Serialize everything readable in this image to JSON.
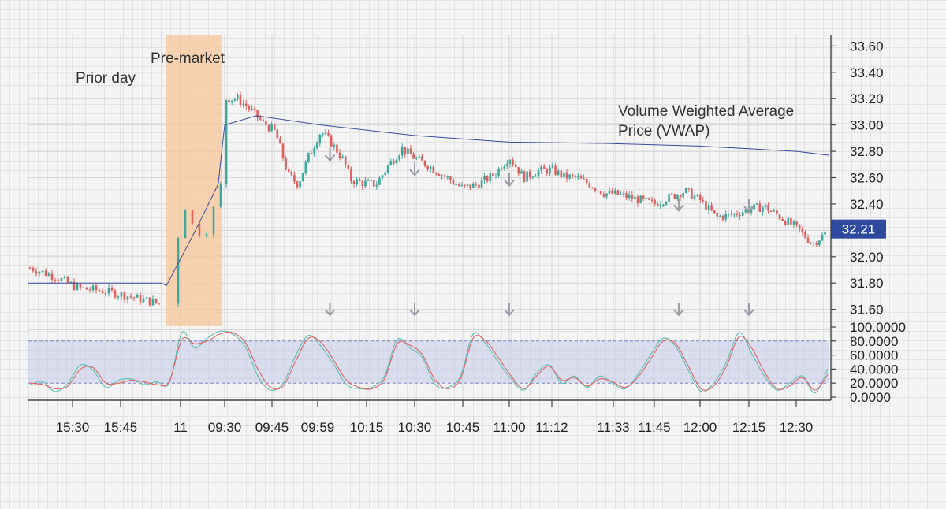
{
  "chart_data": {
    "type": "candlestick",
    "x_tick_labels": [
      "15:30",
      "15:45",
      "11",
      "09:30",
      "09:45",
      "09:59",
      "10:15",
      "10:30",
      "10:45",
      "11:00",
      "11:12",
      "11:33",
      "11:45",
      "12:00",
      "12:15",
      "12:30"
    ],
    "price_axis": {
      "ylim": [
        31.55,
        33.65
      ],
      "tick_values": [
        31.6,
        31.8,
        32.0,
        32.2,
        32.4,
        32.6,
        32.8,
        33.0,
        33.2,
        33.4,
        33.6
      ],
      "tick_labels": [
        "31.60",
        "31.80",
        "32.00",
        "32.20",
        "32.40",
        "32.60",
        "32.80",
        "33.00",
        "33.20",
        "33.40",
        "33.60"
      ]
    },
    "last_price_label": "32.21",
    "last_price": 32.21,
    "annotations": {
      "prior_day": "Prior day",
      "pre_market": "Pre-market",
      "vwap_line1": "Volume Weighted Average",
      "vwap_line2": "Price (VWAP)"
    },
    "vwap": {
      "x": [
        "15:20",
        "15:54",
        "08:00",
        "08:30",
        "08:45",
        "09:20",
        "09:30",
        "09:40",
        "10:00",
        "10:30",
        "11:00",
        "11:30",
        "12:00",
        "12:15",
        "12:30",
        "12:40"
      ],
      "values": [
        31.8,
        31.8,
        31.78,
        32.06,
        32.2,
        32.55,
        33.0,
        33.07,
        33.0,
        32.92,
        32.87,
        32.86,
        32.84,
        32.82,
        32.8,
        32.77
      ]
    },
    "price_path": {
      "x": [
        "15:20",
        "15:26",
        "15:32",
        "15:40",
        "15:48",
        "15:54",
        "08:30",
        "08:45",
        "09:05",
        "09:15",
        "09:25",
        "09:30",
        "09:34",
        "09:38",
        "09:42",
        "09:46",
        "09:50",
        "09:53",
        "09:56",
        "10:00",
        "10:03",
        "10:07",
        "10:10",
        "10:14",
        "10:18",
        "10:22",
        "10:26",
        "10:30",
        "10:35",
        "10:40",
        "10:45",
        "10:50",
        "10:55",
        "11:00",
        "11:04",
        "11:08",
        "11:12",
        "11:16",
        "11:20",
        "11:25",
        "11:30",
        "11:33",
        "11:38",
        "11:45",
        "11:50",
        "11:55",
        "12:00",
        "12:05",
        "12:10",
        "12:15",
        "12:20",
        "12:25",
        "12:30",
        "12:35",
        "12:40"
      ],
      "values": [
        31.92,
        31.85,
        31.76,
        31.74,
        31.69,
        31.64,
        32.4,
        32.17,
        32.21,
        32.4,
        32.55,
        33.2,
        33.2,
        33.12,
        33.02,
        32.95,
        32.62,
        32.55,
        32.75,
        32.95,
        32.88,
        32.75,
        32.58,
        32.56,
        32.55,
        32.7,
        32.82,
        32.75,
        32.68,
        32.6,
        32.52,
        32.55,
        32.62,
        32.76,
        32.6,
        32.65,
        32.66,
        32.61,
        32.6,
        32.55,
        32.48,
        32.48,
        32.45,
        32.4,
        32.45,
        32.5,
        32.43,
        32.3,
        32.32,
        32.36,
        32.38,
        32.3,
        32.22,
        32.1,
        32.2
      ]
    },
    "session_gap_label": "11",
    "signal_arrows": {
      "price_panel": [
        {
          "x": "10:03",
          "y": 32.73
        },
        {
          "x": "10:30",
          "y": 32.62
        },
        {
          "x": "11:00",
          "y": 32.54
        },
        {
          "x": "11:53",
          "y": 32.35
        },
        {
          "x": "12:15",
          "y": 32.34
        }
      ],
      "oscillator_panel": [
        "10:03",
        "10:30",
        "11:00",
        "11:53",
        "12:15"
      ]
    },
    "oscillator": {
      "ylim": [
        0,
        100
      ],
      "tick_values": [
        0,
        20,
        40,
        60,
        80,
        100
      ],
      "tick_labels": [
        "0.0000",
        "20.0000",
        "40.0000",
        "60.0000",
        "80.0000",
        "100.0000"
      ],
      "overbought": 80,
      "oversold": 20,
      "band_color": "#c8cdea",
      "series": [
        {
          "color": "#5bbfb0",
          "values": [
            18,
            22,
            8,
            20,
            46,
            38,
            14,
            24,
            26,
            18,
            22,
            20,
            92,
            70,
            84,
            94,
            90,
            72,
            30,
            10,
            20,
            60,
            88,
            72,
            46,
            18,
            12,
            14,
            30,
            82,
            70,
            56,
            18,
            14,
            30,
            90,
            76,
            50,
            26,
            10,
            34,
            46,
            20,
            30,
            14,
            30,
            20,
            12,
            32,
            60,
            84,
            72,
            38,
            8,
            20,
            50,
            92,
            62,
            30,
            10,
            20,
            30,
            6,
            40
          ]
        },
        {
          "color": "#e06262",
          "values": [
            20,
            18,
            12,
            16,
            40,
            42,
            20,
            20,
            24,
            22,
            18,
            22,
            82,
            76,
            80,
            90,
            92,
            78,
            40,
            14,
            16,
            52,
            84,
            78,
            52,
            24,
            14,
            12,
            26,
            76,
            74,
            60,
            24,
            12,
            26,
            84,
            80,
            56,
            30,
            12,
            30,
            44,
            24,
            28,
            16,
            26,
            22,
            14,
            28,
            54,
            80,
            76,
            44,
            12,
            16,
            44,
            86,
            70,
            36,
            12,
            16,
            28,
            10,
            32
          ]
        }
      ]
    },
    "colors": {
      "up": "#3aa89a",
      "down": "#df5f5f",
      "vwap": "#3b4a9a",
      "premarket_band": "#f8c79a",
      "last_price_badge": "#2e4a9e",
      "arrow": "#9a9ca6"
    },
    "grid": true
  }
}
